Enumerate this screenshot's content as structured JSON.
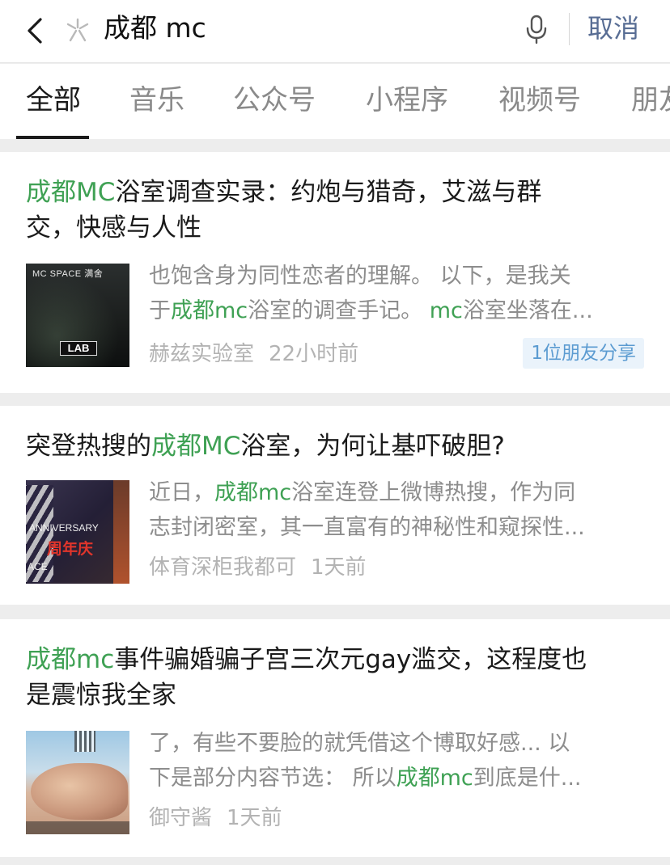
{
  "search": {
    "query": "成都 mc",
    "cancel_label": "取消"
  },
  "tabs": [
    {
      "label": "全部",
      "active": true
    },
    {
      "label": "音乐",
      "active": false
    },
    {
      "label": "公众号",
      "active": false
    },
    {
      "label": "小程序",
      "active": false
    },
    {
      "label": "视频号",
      "active": false
    },
    {
      "label": "朋友",
      "active": false
    }
  ],
  "results": [
    {
      "title_parts": [
        "成都MC",
        "浴室调查实录：约炮与猎奇，艾滋与群"
      ],
      "title_line2": "交，快感与人性",
      "snippet_line1": "也饱含身为同性恋者的理解。 以下，是我关",
      "snippet_line2_parts": [
        "于",
        "成都mc",
        "浴室的调查手记。 ",
        "mc",
        "浴室坐落在..."
      ],
      "thumb_text_top": "MC SPACE 满舍",
      "thumb_text_badge": "LAB",
      "source": "赫兹实验室",
      "time": "22小时前",
      "share_badge": "1位朋友分享"
    },
    {
      "title_parts": [
        "突登热搜的",
        "成都MC",
        "浴室，为何让基吓破胆?"
      ],
      "snippet_line1_parts": [
        "近日，",
        "成都mc",
        "浴室连登上微博热搜，作为同"
      ],
      "snippet_line2": "志封闭密室，其一直富有的神秘性和窥探性...",
      "thumb_text_top": "ANNIVERSARY",
      "thumb_text_badge": "周年庆",
      "thumb_text_bottom": "ACE",
      "source": "体育深柜我都可",
      "time": "1天前"
    },
    {
      "title_parts": [
        "成都mc",
        "事件骗婚骗子宫三次元gay滥交，这程度也"
      ],
      "title_line2": "是震惊我全家",
      "snippet_line1": "了，有些不要脸的就凭借这个博取好感... 以",
      "snippet_line2_parts": [
        "下是部分内容节选： 所以",
        "成都mc",
        "到底是什..."
      ],
      "source": "御守酱",
      "time": "1天前"
    }
  ],
  "colors": {
    "highlight": "#3fa154",
    "cancel": "#586d94",
    "muted": "#8d8d8d",
    "meta": "#b3b3b3"
  },
  "icons": [
    "back-chevron-icon",
    "search-spark-icon",
    "microphone-icon"
  ]
}
